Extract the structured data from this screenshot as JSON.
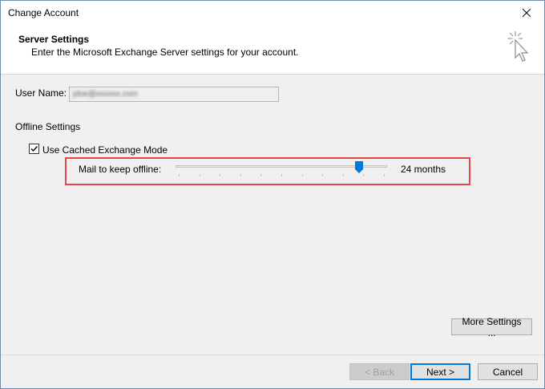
{
  "window": {
    "title": "Change Account"
  },
  "header": {
    "title": "Server Settings",
    "subtitle": "Enter the Microsoft Exchange Server settings for your account."
  },
  "form": {
    "user_name_label": "User Name:",
    "user_name_value": "jdoe@xxxxxx.com",
    "offline_section": "Offline Settings",
    "cached_mode_label": "Use Cached Exchange Mode",
    "cached_mode_checked": true,
    "mail_offline_label": "Mail to keep offline:",
    "mail_offline_value": "24 months",
    "slider_position": 0.85
  },
  "buttons": {
    "more_settings": "More Settings ...",
    "back": "< Back",
    "next": "Next >",
    "cancel": "Cancel"
  },
  "colors": {
    "highlight": "#e2474a",
    "accent": "#0078d7"
  }
}
